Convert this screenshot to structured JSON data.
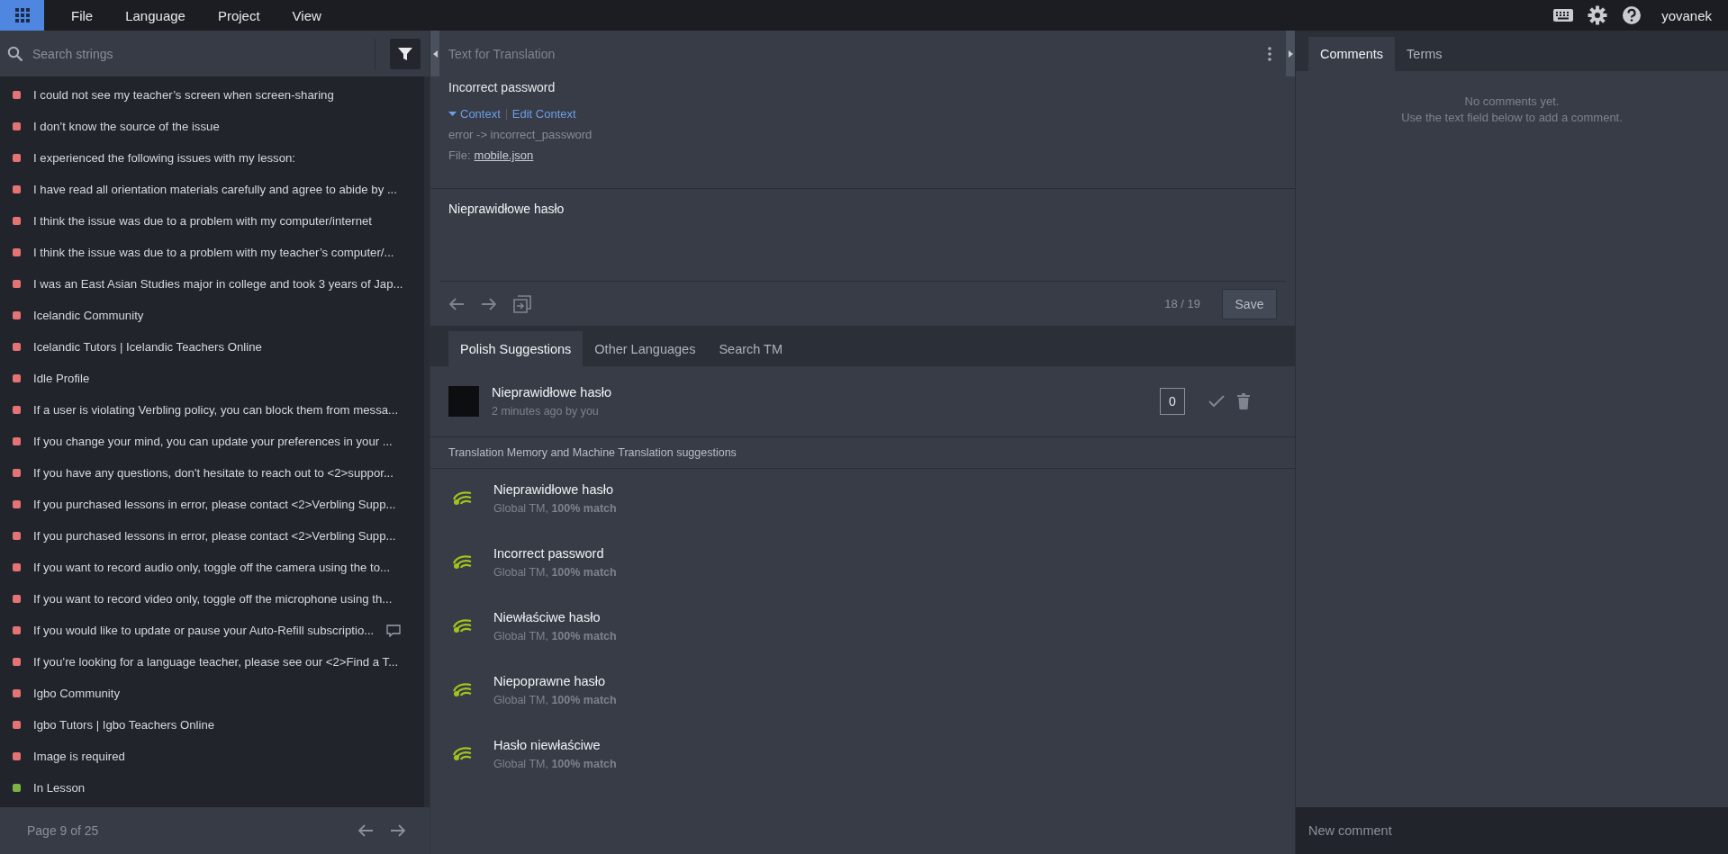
{
  "menu_bar": {
    "items": [
      "File",
      "Language",
      "Project",
      "View"
    ],
    "user": "yovanek"
  },
  "string_list": {
    "search": {
      "placeholder": "Search strings"
    },
    "items": [
      {
        "text": "I could not see my teacher’s screen when screen-sharing",
        "color": "#e57373",
        "has_comment": false
      },
      {
        "text": "I don’t know the source of the issue",
        "color": "#e57373",
        "has_comment": false
      },
      {
        "text": "I experienced the following issues with my lesson:",
        "color": "#e57373",
        "has_comment": false
      },
      {
        "text": "I have read all orientation materials carefully and agree to abide by ...",
        "color": "#e57373",
        "has_comment": false
      },
      {
        "text": "I think the issue was due to a problem with my computer/internet",
        "color": "#e57373",
        "has_comment": false
      },
      {
        "text": "I think the issue was due to a problem with my teacher’s computer/...",
        "color": "#e57373",
        "has_comment": false
      },
      {
        "text": "I was an East Asian Studies major in college and took 3 years of Jap...",
        "color": "#e57373",
        "has_comment": false
      },
      {
        "text": "Icelandic Community",
        "color": "#e57373",
        "has_comment": false
      },
      {
        "text": "Icelandic Tutors | Icelandic Teachers Online",
        "color": "#e57373",
        "has_comment": false
      },
      {
        "text": "Idle Profile",
        "color": "#e57373",
        "has_comment": false
      },
      {
        "text": "If a user is violating Verbling policy, you can block them from messa...",
        "color": "#e57373",
        "has_comment": false
      },
      {
        "text": "If you change your mind, you can update your preferences in your ...",
        "color": "#e57373",
        "has_comment": false
      },
      {
        "text": "If you have any questions, don't hesitate to reach out to <2>suppor...",
        "color": "#e57373",
        "has_comment": false
      },
      {
        "text": "If you purchased lessons in error, please contact <2>Verbling Supp...",
        "color": "#e57373",
        "has_comment": false
      },
      {
        "text": "If you purchased lessons in error, please contact <2>Verbling Supp...",
        "color": "#e57373",
        "has_comment": false
      },
      {
        "text": "If you want to record audio only, toggle off the camera using the to...",
        "color": "#e57373",
        "has_comment": false
      },
      {
        "text": "If you want to record video only, toggle off the microphone using th...",
        "color": "#e57373",
        "has_comment": false
      },
      {
        "text": "If you would like to update or pause your Auto-Refill subscriptio...",
        "color": "#e57373",
        "has_comment": true
      },
      {
        "text": "If you’re looking for a language teacher, please see our <2>Find a T...",
        "color": "#e57373",
        "has_comment": false
      },
      {
        "text": "Igbo Community",
        "color": "#e57373",
        "has_comment": false
      },
      {
        "text": "Igbo Tutors | Igbo Teachers Online",
        "color": "#e57373",
        "has_comment": false
      },
      {
        "text": "Image is required",
        "color": "#e57373",
        "has_comment": false
      },
      {
        "text": "In Lesson",
        "color": "#7cb342",
        "has_comment": false
      }
    ],
    "pager": "Page 9 of 25"
  },
  "editor": {
    "header": "Text for Translation",
    "source": "Incorrect password",
    "context": {
      "expanded": true,
      "label": "Context",
      "edit_label": "Edit Context",
      "key": "error -> incorrect_password",
      "file_label": "File:",
      "file": "mobile.json"
    },
    "translation": "Nieprawidłowe hasło",
    "counter": "18 / 19",
    "save": "Save"
  },
  "suggestions": {
    "tabs": [
      {
        "label": "Polish Suggestions",
        "selected": true
      },
      {
        "label": "Other Languages",
        "selected": false
      },
      {
        "label": "Search TM",
        "selected": false
      }
    ],
    "own": [
      {
        "text": "Nieprawidłowe hasło",
        "meta": "2 minutes ago by you",
        "votes": "0"
      }
    ],
    "tm_header": "Translation Memory and Machine Translation suggestions",
    "tm": [
      {
        "text": "Nieprawidłowe hasło",
        "meta": "Global TM, **100% match**"
      },
      {
        "text": "Incorrect password",
        "meta": "Global TM, **100% match**"
      },
      {
        "text": "Niewłaściwe hasło",
        "meta": "Global TM, **100% match**"
      },
      {
        "text": "Niepoprawne hasło",
        "meta": "Global TM, **100% match**"
      },
      {
        "text": "Hasło niewłaściwe",
        "meta": "Global TM, **100% match**"
      }
    ]
  },
  "side": {
    "tabs": [
      {
        "label": "Comments",
        "selected": true
      },
      {
        "label": "Terms",
        "selected": false
      }
    ],
    "empty": [
      "No comments yet.",
      "Use the text field below to add a comment."
    ],
    "new_comment": {
      "placeholder": "New comment"
    }
  }
}
